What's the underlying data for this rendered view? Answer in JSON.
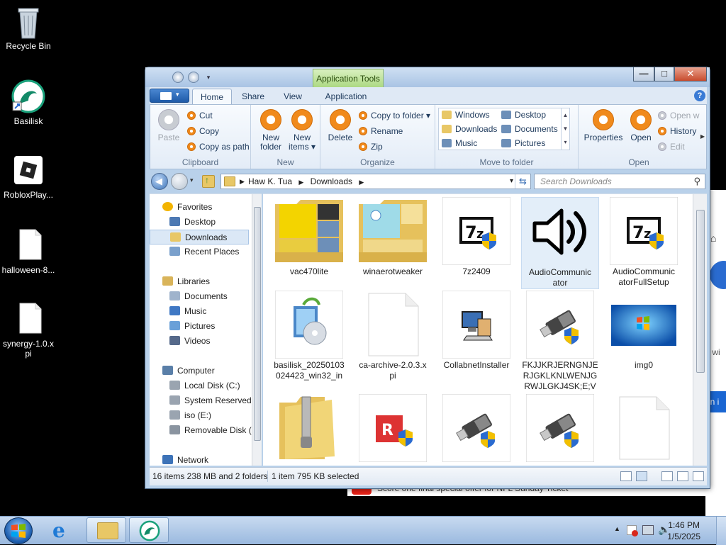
{
  "desktop": {
    "icons": [
      {
        "label": "Recycle Bin",
        "icon": "recycle-bin-icon"
      },
      {
        "label": "Basilisk",
        "icon": "basilisk-icon"
      },
      {
        "label": "RobloxPlay...",
        "icon": "roblox-icon"
      },
      {
        "label": "halloween-8...",
        "icon": "file-icon"
      },
      {
        "label": "synergy-1.0.x\npi",
        "icon": "file-icon"
      }
    ]
  },
  "background_window": {
    "text_fragment_1": "y wi",
    "text_fragment_2": "gn i",
    "promo": "Score one final special offer for NFL Sunday Ticket"
  },
  "explorer": {
    "context_tab": "Application Tools",
    "window_buttons": {
      "minimize": "—",
      "maximize": "□",
      "close": "✕"
    },
    "tabs": [
      "Home",
      "Share",
      "View",
      "Application"
    ],
    "active_tab": "Home",
    "help": "?",
    "ribbon": {
      "clipboard": {
        "label": "Clipboard",
        "paste": "Paste",
        "cut": "Cut",
        "copy": "Copy",
        "copy_as_path": "Copy as path"
      },
      "new": {
        "label": "New",
        "new_folder": "New\nfolder",
        "new_items": "New\nitems ▾"
      },
      "organize": {
        "label": "Organize",
        "delete": "Delete",
        "copy_to": "Copy to folder ▾",
        "rename": "Rename",
        "zip": "Zip"
      },
      "move_to": {
        "label": "Move to folder",
        "items": [
          "Windows",
          "Desktop",
          "Downloads",
          "Documents",
          "Music",
          "Pictures"
        ]
      },
      "open": {
        "label": "Open",
        "properties": "Properties",
        "open": "Open",
        "open_with": "Open w",
        "history": "History",
        "edit": "Edit"
      }
    },
    "address": {
      "crumbs": [
        "Haw K. Tua",
        "Downloads"
      ],
      "search_placeholder": "Search Downloads"
    },
    "nav": {
      "items": [
        {
          "label": "Favorites",
          "icon": "star-icon",
          "level": 0
        },
        {
          "label": "Desktop",
          "icon": "desktop-icon",
          "level": 1
        },
        {
          "label": "Downloads",
          "icon": "downloads-icon",
          "level": 1,
          "selected": true
        },
        {
          "label": "Recent Places",
          "icon": "recent-places-icon",
          "level": 1
        },
        {
          "label": "Libraries",
          "icon": "libraries-icon",
          "level": 0
        },
        {
          "label": "Documents",
          "icon": "documents-icon",
          "level": 1
        },
        {
          "label": "Music",
          "icon": "music-icon",
          "level": 1
        },
        {
          "label": "Pictures",
          "icon": "pictures-icon",
          "level": 1
        },
        {
          "label": "Videos",
          "icon": "videos-icon",
          "level": 1
        },
        {
          "label": "Computer",
          "icon": "computer-icon",
          "level": 0
        },
        {
          "label": "Local Disk (C:)",
          "icon": "disk-icon",
          "level": 1
        },
        {
          "label": "System Reserved",
          "icon": "disk-icon",
          "level": 1
        },
        {
          "label": "iso (E:)",
          "icon": "disk-icon",
          "level": 1
        },
        {
          "label": "Removable Disk (",
          "icon": "removable-disk-icon",
          "level": 1
        },
        {
          "label": "Network",
          "icon": "network-icon",
          "level": 0
        }
      ]
    },
    "files": [
      {
        "name": "vac470lite",
        "kind": "folder-yellow"
      },
      {
        "name": "winaerotweaker",
        "kind": "folder-blue"
      },
      {
        "name": "7z2409",
        "kind": "7z"
      },
      {
        "name": "AudioCommunic\nator",
        "kind": "speaker",
        "selected": true
      },
      {
        "name": "AudioCommunic\natorFullSetup",
        "kind": "7z"
      },
      {
        "name": "basilisk_20250103\n024423_win32_in",
        "kind": "installer"
      },
      {
        "name": "ca-archive-2.0.3.x\npi",
        "kind": "blank"
      },
      {
        "name": "CollabnetInstaller",
        "kind": "computer"
      },
      {
        "name": "FKJJKRJERNGNJE\nRJGKLKNLWENJG\nRWJLGKJ4SK;E;V",
        "kind": "usb"
      },
      {
        "name": "img0",
        "kind": "wallpaper"
      },
      {
        "name": "",
        "kind": "zip"
      },
      {
        "name": "",
        "kind": "red-app"
      },
      {
        "name": "",
        "kind": "usb"
      },
      {
        "name": "",
        "kind": "usb"
      },
      {
        "name": "",
        "kind": "blank"
      }
    ],
    "status": {
      "count": "16 items 238 MB and 2 folders",
      "selected": "1 item 795 KB selected"
    }
  },
  "taskbar": {
    "clock_time": "1:46 PM",
    "clock_date": "1/5/2025",
    "tray_arrow": "▲"
  }
}
